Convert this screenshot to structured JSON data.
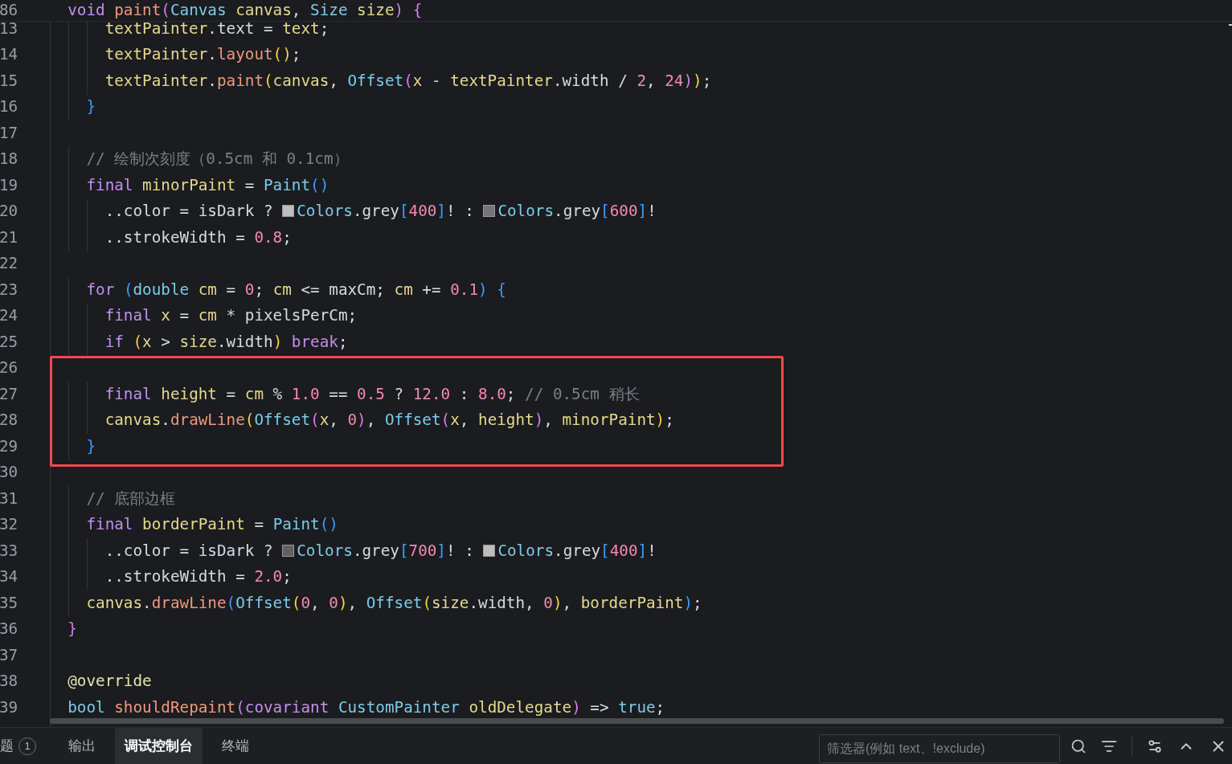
{
  "editor": {
    "sticky_line": {
      "number": "86",
      "tokens": [
        {
          "kind": "kw",
          "text": "  void "
        },
        {
          "kind": "fn",
          "text": "paint"
        },
        {
          "kind": "b2",
          "text": "("
        },
        {
          "kind": "type",
          "text": "Canvas "
        },
        {
          "kind": "var",
          "text": "canvas"
        },
        {
          "kind": "plain",
          "text": ", "
        },
        {
          "kind": "type",
          "text": "Size "
        },
        {
          "kind": "var",
          "text": "size"
        },
        {
          "kind": "b2",
          "text": ") {"
        }
      ]
    },
    "lines": [
      {
        "number": "13",
        "tokens": [
          {
            "kind": "var",
            "text": "      textPainter"
          },
          {
            "kind": "plain",
            "text": ".text = "
          },
          {
            "kind": "var",
            "text": "text"
          },
          {
            "kind": "plain",
            "text": ";"
          }
        ]
      },
      {
        "number": "14",
        "tokens": [
          {
            "kind": "var",
            "text": "      textPainter"
          },
          {
            "kind": "plain",
            "text": "."
          },
          {
            "kind": "fn",
            "text": "layout"
          },
          {
            "kind": "b1",
            "text": "()"
          },
          {
            "kind": "plain",
            "text": ";"
          }
        ]
      },
      {
        "number": "15",
        "tokens": [
          {
            "kind": "var",
            "text": "      textPainter"
          },
          {
            "kind": "plain",
            "text": "."
          },
          {
            "kind": "fn",
            "text": "paint"
          },
          {
            "kind": "b1",
            "text": "("
          },
          {
            "kind": "var",
            "text": "canvas"
          },
          {
            "kind": "plain",
            "text": ", "
          },
          {
            "kind": "type",
            "text": "Offset"
          },
          {
            "kind": "b2",
            "text": "("
          },
          {
            "kind": "var",
            "text": "x"
          },
          {
            "kind": "plain",
            "text": " - "
          },
          {
            "kind": "var",
            "text": "textPainter"
          },
          {
            "kind": "plain",
            "text": ".width / "
          },
          {
            "kind": "num",
            "text": "2"
          },
          {
            "kind": "plain",
            "text": ", "
          },
          {
            "kind": "num",
            "text": "24"
          },
          {
            "kind": "b2",
            "text": ")"
          },
          {
            "kind": "b1",
            "text": ")"
          },
          {
            "kind": "plain",
            "text": ";"
          }
        ]
      },
      {
        "number": "16",
        "tokens": [
          {
            "kind": "b3",
            "text": "    }"
          }
        ]
      },
      {
        "number": "17"
      },
      {
        "number": "18",
        "tokens": [
          {
            "kind": "cmt",
            "text": "    // 绘制次刻度（0.5cm 和 0.1cm）"
          }
        ]
      },
      {
        "number": "19",
        "tokens": [
          {
            "kind": "kw",
            "text": "    final "
          },
          {
            "kind": "var",
            "text": "minorPaint"
          },
          {
            "kind": "plain",
            "text": " = "
          },
          {
            "kind": "type",
            "text": "Paint"
          },
          {
            "kind": "b3",
            "text": "()"
          }
        ]
      },
      {
        "number": "20",
        "tokens": [
          {
            "kind": "plain",
            "text": "      ..color = isDark ? "
          },
          {
            "kind": "swatch",
            "color": "#bdbdbd"
          },
          {
            "kind": "type",
            "text": "Colors"
          },
          {
            "kind": "plain",
            "text": ".grey"
          },
          {
            "kind": "b3",
            "text": "["
          },
          {
            "kind": "num",
            "text": "400"
          },
          {
            "kind": "b3",
            "text": "]"
          },
          {
            "kind": "plain",
            "text": "! : "
          },
          {
            "kind": "swatch",
            "color": "#757575"
          },
          {
            "kind": "type",
            "text": "Colors"
          },
          {
            "kind": "plain",
            "text": ".grey"
          },
          {
            "kind": "b3",
            "text": "["
          },
          {
            "kind": "num",
            "text": "600"
          },
          {
            "kind": "b3",
            "text": "]"
          },
          {
            "kind": "plain",
            "text": "!"
          }
        ]
      },
      {
        "number": "21",
        "tokens": [
          {
            "kind": "plain",
            "text": "      ..strokeWidth = "
          },
          {
            "kind": "num",
            "text": "0.8"
          },
          {
            "kind": "plain",
            "text": ";"
          }
        ]
      },
      {
        "number": "22"
      },
      {
        "number": "23",
        "tokens": [
          {
            "kind": "kw",
            "text": "    for "
          },
          {
            "kind": "b3",
            "text": "("
          },
          {
            "kind": "type",
            "text": "double "
          },
          {
            "kind": "var",
            "text": "cm"
          },
          {
            "kind": "plain",
            "text": " = "
          },
          {
            "kind": "num",
            "text": "0"
          },
          {
            "kind": "plain",
            "text": "; "
          },
          {
            "kind": "var",
            "text": "cm"
          },
          {
            "kind": "plain",
            "text": " <= maxCm; "
          },
          {
            "kind": "var",
            "text": "cm"
          },
          {
            "kind": "plain",
            "text": " += "
          },
          {
            "kind": "num",
            "text": "0.1"
          },
          {
            "kind": "b3",
            "text": ") {"
          }
        ]
      },
      {
        "number": "24",
        "tokens": [
          {
            "kind": "kw",
            "text": "      final "
          },
          {
            "kind": "var",
            "text": "x"
          },
          {
            "kind": "plain",
            "text": " = "
          },
          {
            "kind": "var",
            "text": "cm"
          },
          {
            "kind": "plain",
            "text": " * pixelsPerCm;"
          }
        ]
      },
      {
        "number": "25",
        "tokens": [
          {
            "kind": "kw",
            "text": "      if "
          },
          {
            "kind": "b1",
            "text": "("
          },
          {
            "kind": "var",
            "text": "x"
          },
          {
            "kind": "plain",
            "text": " > "
          },
          {
            "kind": "var",
            "text": "size"
          },
          {
            "kind": "plain",
            "text": ".width"
          },
          {
            "kind": "b1",
            "text": ")"
          },
          {
            "kind": "kw",
            "text": " break"
          },
          {
            "kind": "plain",
            "text": ";"
          }
        ]
      },
      {
        "number": "26"
      },
      {
        "number": "27",
        "tokens": [
          {
            "kind": "kw",
            "text": "      final "
          },
          {
            "kind": "var",
            "text": "height"
          },
          {
            "kind": "plain",
            "text": " = "
          },
          {
            "kind": "var",
            "text": "cm"
          },
          {
            "kind": "plain",
            "text": " % "
          },
          {
            "kind": "num",
            "text": "1.0"
          },
          {
            "kind": "plain",
            "text": " == "
          },
          {
            "kind": "num",
            "text": "0.5"
          },
          {
            "kind": "plain",
            "text": " ? "
          },
          {
            "kind": "num",
            "text": "12.0"
          },
          {
            "kind": "plain",
            "text": " : "
          },
          {
            "kind": "num",
            "text": "8.0"
          },
          {
            "kind": "plain",
            "text": "; "
          },
          {
            "kind": "cmt",
            "text": "// 0.5cm 稍长"
          }
        ]
      },
      {
        "number": "28",
        "tokens": [
          {
            "kind": "var",
            "text": "      canvas"
          },
          {
            "kind": "plain",
            "text": "."
          },
          {
            "kind": "fn",
            "text": "drawLine"
          },
          {
            "kind": "b1",
            "text": "("
          },
          {
            "kind": "type",
            "text": "Offset"
          },
          {
            "kind": "b2",
            "text": "("
          },
          {
            "kind": "var",
            "text": "x"
          },
          {
            "kind": "plain",
            "text": ", "
          },
          {
            "kind": "num",
            "text": "0"
          },
          {
            "kind": "b2",
            "text": ")"
          },
          {
            "kind": "plain",
            "text": ", "
          },
          {
            "kind": "type",
            "text": "Offset"
          },
          {
            "kind": "b2",
            "text": "("
          },
          {
            "kind": "var",
            "text": "x"
          },
          {
            "kind": "plain",
            "text": ", "
          },
          {
            "kind": "var",
            "text": "height"
          },
          {
            "kind": "b2",
            "text": ")"
          },
          {
            "kind": "plain",
            "text": ", "
          },
          {
            "kind": "var",
            "text": "minorPaint"
          },
          {
            "kind": "b1",
            "text": ")"
          },
          {
            "kind": "plain",
            "text": ";"
          }
        ]
      },
      {
        "number": "29",
        "tokens": [
          {
            "kind": "b3",
            "text": "    }"
          }
        ]
      },
      {
        "number": "30"
      },
      {
        "number": "31",
        "tokens": [
          {
            "kind": "cmt",
            "text": "    // 底部边框"
          }
        ]
      },
      {
        "number": "32",
        "tokens": [
          {
            "kind": "kw",
            "text": "    final "
          },
          {
            "kind": "var",
            "text": "borderPaint"
          },
          {
            "kind": "plain",
            "text": " = "
          },
          {
            "kind": "type",
            "text": "Paint"
          },
          {
            "kind": "b3",
            "text": "()"
          }
        ]
      },
      {
        "number": "33",
        "tokens": [
          {
            "kind": "plain",
            "text": "      ..color = isDark ? "
          },
          {
            "kind": "swatch",
            "color": "#616161"
          },
          {
            "kind": "type",
            "text": "Colors"
          },
          {
            "kind": "plain",
            "text": ".grey"
          },
          {
            "kind": "b3",
            "text": "["
          },
          {
            "kind": "num",
            "text": "700"
          },
          {
            "kind": "b3",
            "text": "]"
          },
          {
            "kind": "plain",
            "text": "! : "
          },
          {
            "kind": "swatch",
            "color": "#bdbdbd"
          },
          {
            "kind": "type",
            "text": "Colors"
          },
          {
            "kind": "plain",
            "text": ".grey"
          },
          {
            "kind": "b3",
            "text": "["
          },
          {
            "kind": "num",
            "text": "400"
          },
          {
            "kind": "b3",
            "text": "]"
          },
          {
            "kind": "plain",
            "text": "!"
          }
        ]
      },
      {
        "number": "34",
        "tokens": [
          {
            "kind": "plain",
            "text": "      ..strokeWidth = "
          },
          {
            "kind": "num",
            "text": "2.0"
          },
          {
            "kind": "plain",
            "text": ";"
          }
        ]
      },
      {
        "number": "35",
        "tokens": [
          {
            "kind": "var",
            "text": "    canvas"
          },
          {
            "kind": "plain",
            "text": "."
          },
          {
            "kind": "fn",
            "text": "drawLine"
          },
          {
            "kind": "b3",
            "text": "("
          },
          {
            "kind": "type",
            "text": "Offset"
          },
          {
            "kind": "b1",
            "text": "("
          },
          {
            "kind": "num",
            "text": "0"
          },
          {
            "kind": "plain",
            "text": ", "
          },
          {
            "kind": "num",
            "text": "0"
          },
          {
            "kind": "b1",
            "text": ")"
          },
          {
            "kind": "plain",
            "text": ", "
          },
          {
            "kind": "type",
            "text": "Offset"
          },
          {
            "kind": "b1",
            "text": "("
          },
          {
            "kind": "var",
            "text": "size"
          },
          {
            "kind": "plain",
            "text": ".width, "
          },
          {
            "kind": "num",
            "text": "0"
          },
          {
            "kind": "b1",
            "text": ")"
          },
          {
            "kind": "plain",
            "text": ", "
          },
          {
            "kind": "var",
            "text": "borderPaint"
          },
          {
            "kind": "b3",
            "text": ")"
          },
          {
            "kind": "plain",
            "text": ";"
          }
        ]
      },
      {
        "number": "36",
        "tokens": [
          {
            "kind": "b2",
            "text": "  }"
          }
        ]
      },
      {
        "number": "37"
      },
      {
        "number": "38",
        "tokens": [
          {
            "kind": "anno",
            "text": "  @override"
          }
        ]
      },
      {
        "number": "39",
        "tokens": [
          {
            "kind": "type",
            "text": "  bool "
          },
          {
            "kind": "fn",
            "text": "shouldRepaint"
          },
          {
            "kind": "b2",
            "text": "("
          },
          {
            "kind": "kw",
            "text": "covariant "
          },
          {
            "kind": "type",
            "text": "CustomPainter "
          },
          {
            "kind": "var",
            "text": "oldDelegate"
          },
          {
            "kind": "b2",
            "text": ")"
          },
          {
            "kind": "plain",
            "text": " => "
          },
          {
            "kind": "type",
            "text": "true"
          },
          {
            "kind": "plain",
            "text": ";"
          }
        ]
      }
    ]
  },
  "panel": {
    "tabs": [
      {
        "label": "题",
        "badge": "1",
        "selected": false
      },
      {
        "label": "输出",
        "selected": false
      },
      {
        "label": "调试控制台",
        "selected": true
      },
      {
        "label": "终端",
        "selected": false
      }
    ],
    "filter": {
      "placeholder": "筛选器(例如 text、!exclude)"
    }
  }
}
